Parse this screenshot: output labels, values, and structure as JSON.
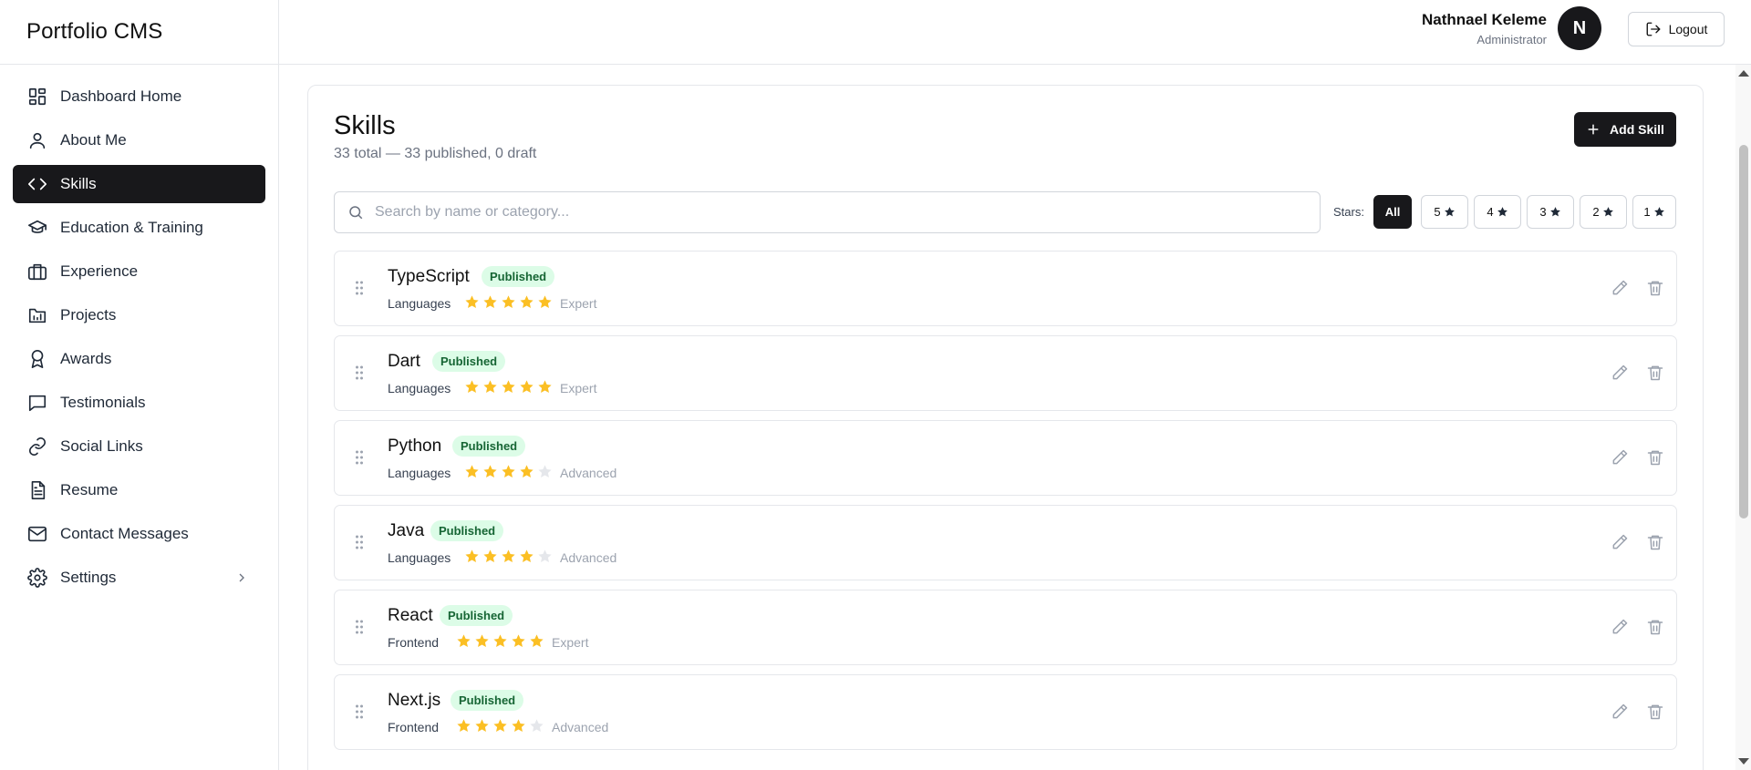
{
  "app": {
    "title": "Portfolio CMS"
  },
  "sidebar": {
    "items": [
      {
        "label": "Dashboard Home",
        "icon": "dashboard-icon"
      },
      {
        "label": "About Me",
        "icon": "user-icon"
      },
      {
        "label": "Skills",
        "icon": "code-icon",
        "active": true
      },
      {
        "label": "Education & Training",
        "icon": "graduation-cap-icon"
      },
      {
        "label": "Experience",
        "icon": "briefcase-icon"
      },
      {
        "label": "Projects",
        "icon": "folder-icon"
      },
      {
        "label": "Awards",
        "icon": "award-icon"
      },
      {
        "label": "Testimonials",
        "icon": "message-icon"
      },
      {
        "label": "Social Links",
        "icon": "link-icon"
      },
      {
        "label": "Resume",
        "icon": "file-icon"
      },
      {
        "label": "Contact Messages",
        "icon": "mail-icon"
      },
      {
        "label": "Settings",
        "icon": "gear-icon"
      }
    ]
  },
  "header": {
    "user_name": "Nathnael Keleme",
    "user_role": "Administrator",
    "avatar_initial": "N",
    "logout_label": "Logout"
  },
  "page": {
    "title": "Skills",
    "subtitle": "33 total — 33 published, 0 draft",
    "add_label": "Add Skill",
    "search_placeholder": "Search by name or category...",
    "search_value": "",
    "stars_label": "Stars:",
    "filters": [
      "All",
      "5",
      "4",
      "3",
      "2",
      "1"
    ],
    "active_filter": "All"
  },
  "colors": {
    "accent": "#18181b",
    "star_filled": "#fbbf24",
    "star_empty": "#e5e7eb",
    "badge_bg": "#dcfce7",
    "badge_text": "#166534"
  },
  "skills": [
    {
      "name": "TypeScript",
      "status": "Published",
      "category": "Languages",
      "stars": 5,
      "level": "Expert"
    },
    {
      "name": "Dart",
      "status": "Published",
      "category": "Languages",
      "stars": 5,
      "level": "Expert"
    },
    {
      "name": "Python",
      "status": "Published",
      "category": "Languages",
      "stars": 4,
      "level": "Advanced"
    },
    {
      "name": "Java",
      "status": "Published",
      "category": "Languages",
      "stars": 4,
      "level": "Advanced"
    },
    {
      "name": "React",
      "status": "Published",
      "category": "Frontend",
      "stars": 5,
      "level": "Expert"
    },
    {
      "name": "Next.js",
      "status": "Published",
      "category": "Frontend",
      "stars": 4,
      "level": "Advanced"
    }
  ]
}
